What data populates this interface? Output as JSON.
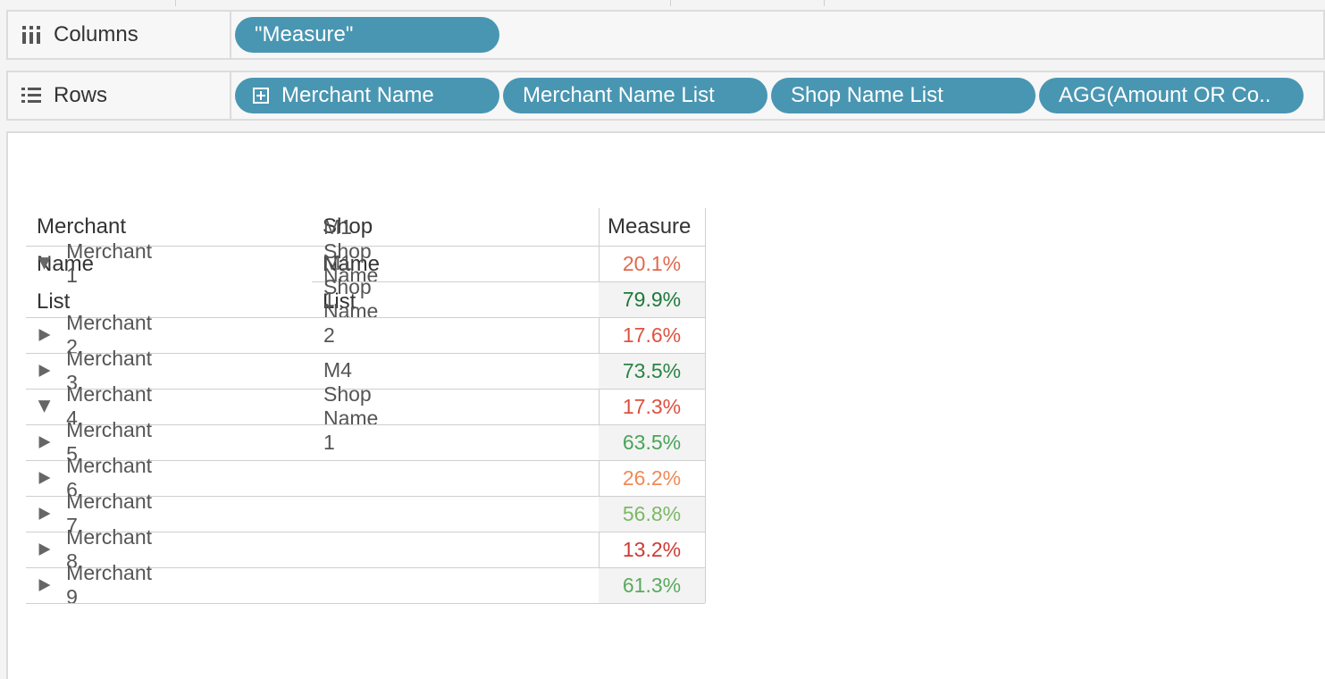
{
  "shelves": {
    "columns": {
      "label": "Columns",
      "icon": "columns-icon",
      "pills": [
        {
          "label": "\"Measure\""
        }
      ]
    },
    "rows": {
      "label": "Rows",
      "icon": "rows-icon",
      "pills": [
        {
          "label": "Merchant Name",
          "icon": "expand-plus-icon"
        },
        {
          "label": "Merchant Name List"
        },
        {
          "label": "Shop Name List"
        },
        {
          "label": "AGG(Amount OR Co.."
        }
      ]
    }
  },
  "table": {
    "headers": {
      "merchant": "Merchant Name List",
      "shop": "Shop Name List",
      "measure": "Measure"
    },
    "rows": [
      {
        "merchant": "Merchant 1",
        "expanded": true,
        "shop": "M1 Shop Name 1",
        "measure": "20.1%",
        "color": "#e06a4e"
      },
      {
        "merchant": "",
        "expanded": null,
        "shop": "M1 Shop Name 2",
        "measure": "79.9%",
        "color": "#1f7a3a"
      },
      {
        "merchant": "Merchant 2",
        "expanded": false,
        "shop": "",
        "measure": "17.6%",
        "color": "#de5340"
      },
      {
        "merchant": "Merchant 3",
        "expanded": false,
        "shop": "",
        "measure": "73.5%",
        "color": "#2a8443"
      },
      {
        "merchant": "Merchant 4",
        "expanded": true,
        "shop": "M4 Shop Name 1",
        "measure": "17.3%",
        "color": "#dd503e"
      },
      {
        "merchant": "Merchant 5",
        "expanded": false,
        "shop": "",
        "measure": "63.5%",
        "color": "#4aa35a"
      },
      {
        "merchant": "Merchant 6",
        "expanded": false,
        "shop": "",
        "measure": "26.2%",
        "color": "#ef8a57"
      },
      {
        "merchant": "Merchant 7",
        "expanded": false,
        "shop": "",
        "measure": "56.8%",
        "color": "#7cb866"
      },
      {
        "merchant": "Merchant 8",
        "expanded": false,
        "shop": "",
        "measure": "13.2%",
        "color": "#cf3a33"
      },
      {
        "merchant": "Merchant 9",
        "expanded": false,
        "shop": "",
        "measure": "61.3%",
        "color": "#5aaa5e"
      }
    ]
  },
  "colors": {
    "pill": "#4996b2",
    "triangle": "#666666"
  }
}
